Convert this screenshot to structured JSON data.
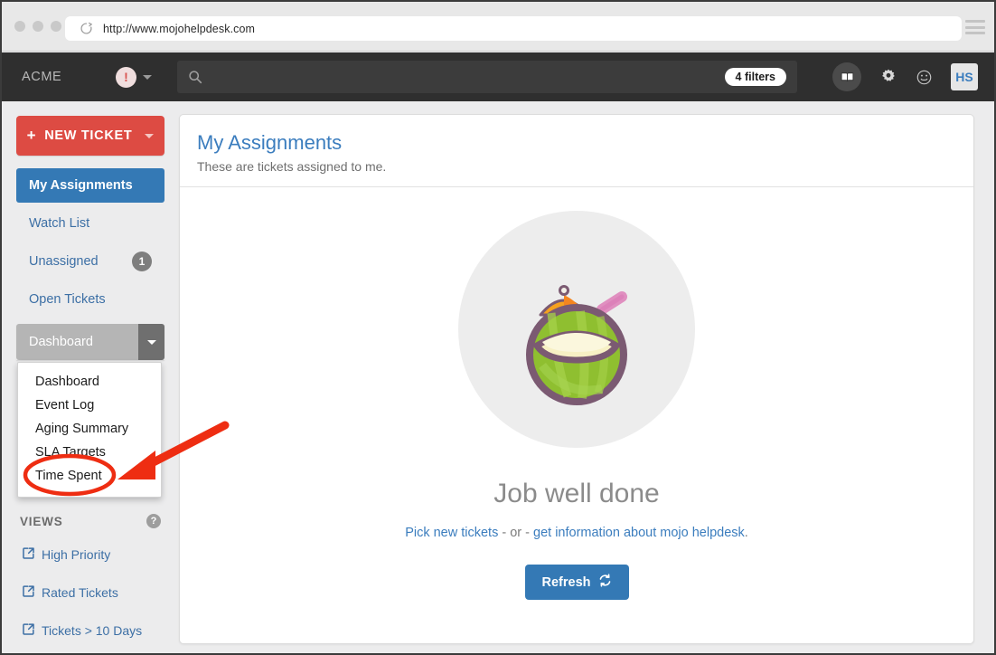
{
  "browser": {
    "url": "http://www.mojohelpdesk.com",
    "reload_icon": "reload-icon",
    "menu_icon": "hamburger-menu-icon"
  },
  "appbar": {
    "brand": "ACME",
    "alert_icon_glyph": "!",
    "search_placeholder": "",
    "search_value": "",
    "search_icon": "search-icon",
    "filters_badge": "4 filters",
    "book_icon": "knowledge-base-icon",
    "gear_icon": "settings-gear-icon",
    "smiley_icon": "feedback-smiley-icon",
    "avatar_initials": "HS"
  },
  "sidebar": {
    "new_ticket_label": "NEW TICKET",
    "nav_items": [
      {
        "label": "My Assignments",
        "badge": "",
        "active": true
      },
      {
        "label": "Watch List",
        "badge": "",
        "active": false
      },
      {
        "label": "Unassigned",
        "badge": "1",
        "active": false
      },
      {
        "label": "Open Tickets",
        "badge": "",
        "active": false
      }
    ],
    "dashboard_select": {
      "selected": "Dashboard",
      "options": [
        "Dashboard",
        "Event Log",
        "Aging Summary",
        "SLA Targets",
        "Time Spent"
      ]
    },
    "views_title": "VIEWS",
    "views_help_glyph": "?",
    "views": [
      {
        "label": "High Priority",
        "icon": "external-link-icon"
      },
      {
        "label": "Rated Tickets",
        "icon": "external-link-icon"
      },
      {
        "label": "Tickets > 10 Days",
        "icon": "external-link-icon"
      }
    ]
  },
  "main": {
    "title": "My Assignments",
    "subtitle": "These are tickets assigned to me.",
    "illustration": "coconut-drink-illustration",
    "empty_title": "Job well done",
    "empty_link_1": "Pick new tickets",
    "empty_separator": " - or - ",
    "empty_link_2": "get information about mojo helpdesk",
    "empty_period": ".",
    "refresh_label": "Refresh",
    "refresh_icon": "refresh-icon"
  },
  "annotation": {
    "highlight_target": "Time Spent",
    "color": "#ee2d12",
    "shape": "ellipse-with-arrow"
  },
  "colors": {
    "accent_blue": "#3479b5",
    "link_blue": "#3b7dbe",
    "danger_red": "#dd4b43",
    "appbar_dark": "#2f2f2f",
    "page_bg": "#ececed",
    "annotation_red": "#ee2d12"
  }
}
